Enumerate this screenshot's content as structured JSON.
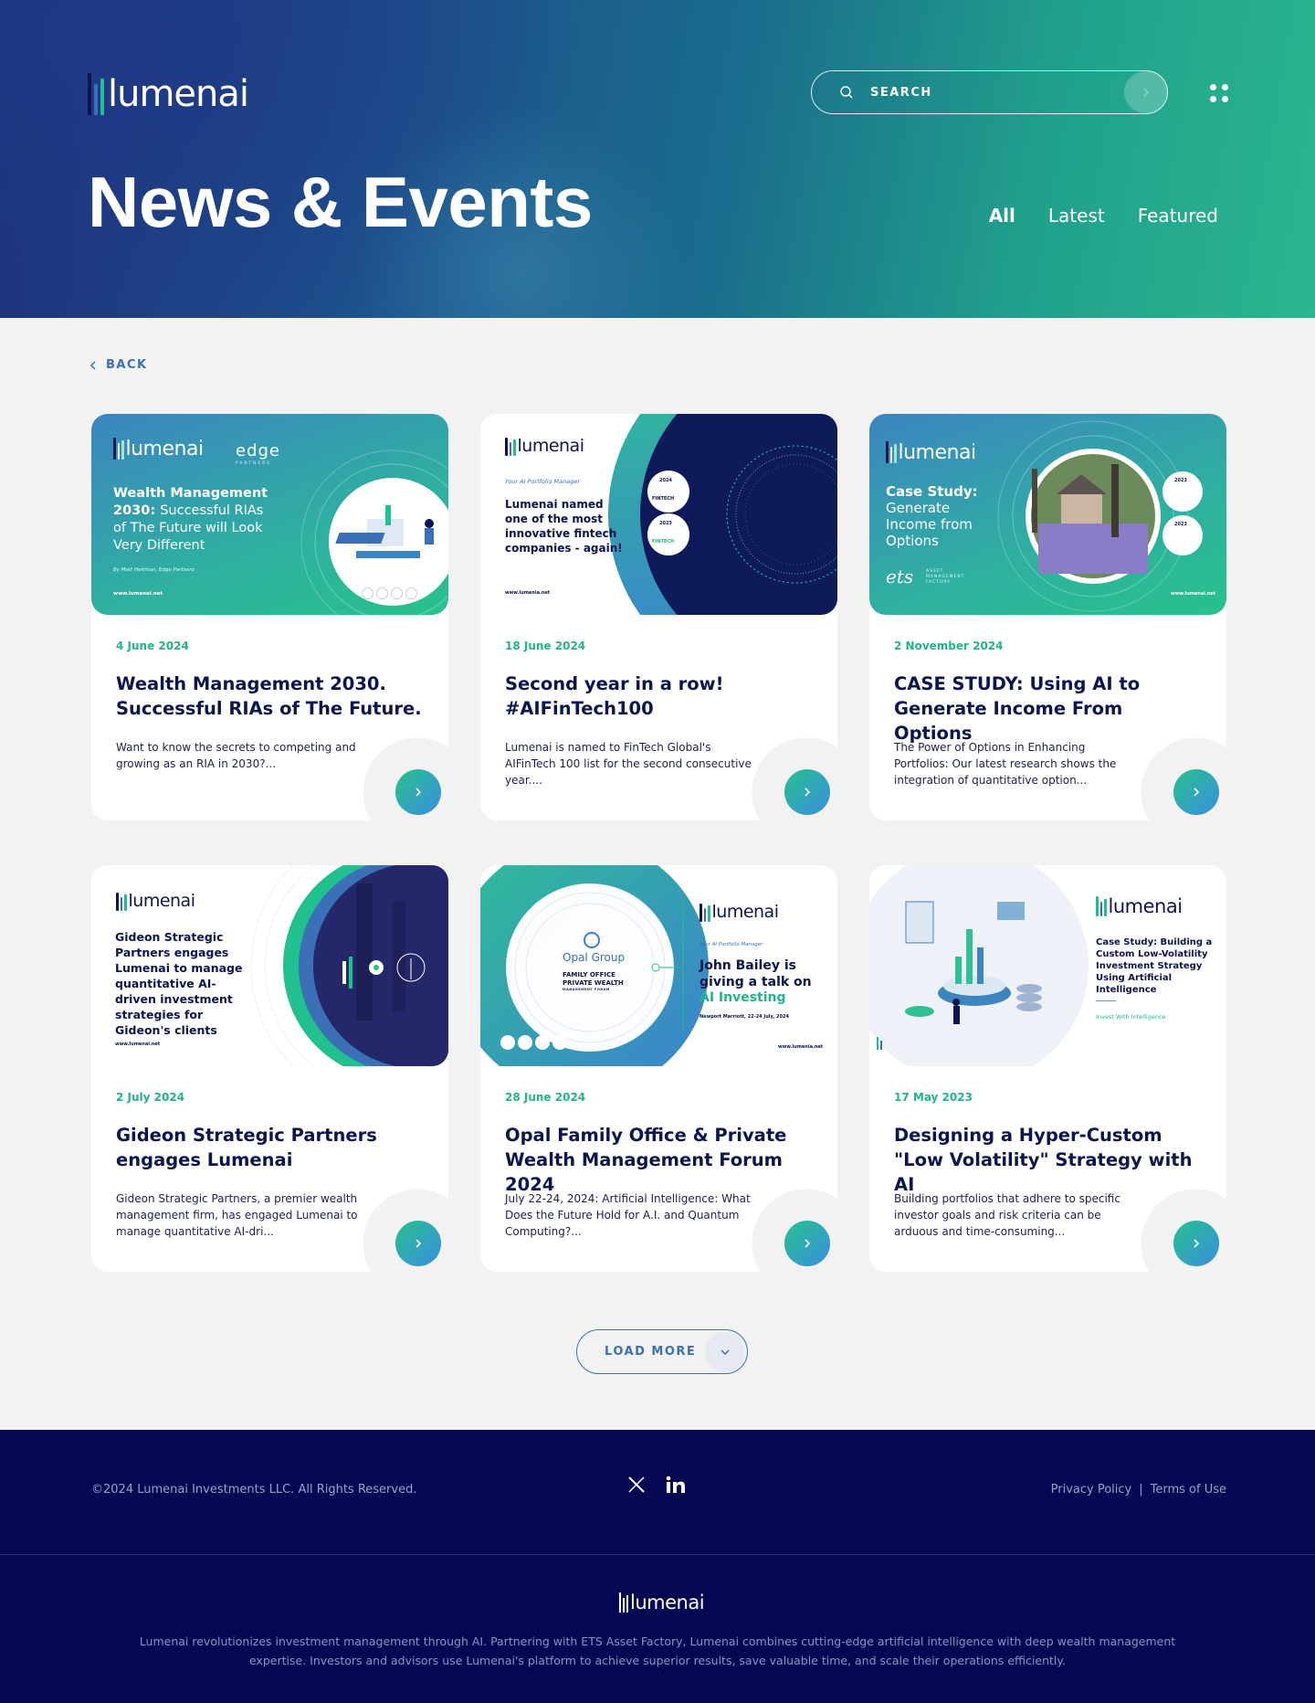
{
  "brand": {
    "name": "lumenai",
    "accent": "#22b48c",
    "navy": "#0d1452",
    "blue": "#3b6fb6"
  },
  "header": {
    "search_label": "SEARCH",
    "page_title": "News & Events",
    "filters": [
      "All",
      "Latest",
      "Featured"
    ],
    "active_filter": "All"
  },
  "nav": {
    "back_label": "BACK"
  },
  "cards": [
    {
      "date": "4 June 2024",
      "title": "Wealth Management 2030. Successful RIAs of The Future.",
      "excerpt": "Want to know the secrets to competing and growing as an RIA in 2030?...",
      "thumb": {
        "partner": "edge",
        "partner_sub": "PARTNERS",
        "head_bold": "Wealth Management 2030:",
        "head_rest": "Successful RIAs of The Future will Look Very Different",
        "byline": "By Matt Heitman, Edge Partners",
        "url": "www.lumenai.net"
      }
    },
    {
      "date": "18 June 2024",
      "title": "Second year in a row! #AIFinTech100",
      "excerpt": "Lumenai is named to FinTech Global's AIFinTech 100 list for the second consecutive year....",
      "thumb": {
        "tagline": "Your AI Portfolio Manager",
        "headline": "Lumenai named one of the most innovative fintech companies - again!",
        "url": "www.lumenia.net",
        "badge_top": "2024",
        "badge_bottom": "2023",
        "badge_label": "FINTECH"
      }
    },
    {
      "date": "2 November 2024",
      "title": "CASE STUDY: Using AI to Generate Income From Options",
      "excerpt": "The Power of Options in Enhancing Portfolios: Our latest research shows the integration of quantitative option...",
      "thumb": {
        "head_bold": "Case Study:",
        "head_rest": "Generate Income from Options",
        "partner": "ets",
        "partner_sub": "ASSET MANAGEMENT FACTORY",
        "url": "www.lumenai.net",
        "badge_top": "2023",
        "badge_bottom": "2023"
      }
    },
    {
      "date": "2 July 2024",
      "title": "Gideon Strategic Partners engages Lumenai",
      "excerpt": "Gideon Strategic Partners, a premier wealth management firm, has engaged Lumenai to manage quantitative AI-dri...",
      "thumb": {
        "headline": "Gideon Strategic Partners engages Lumenai to manage quantitative AI-driven investment strategies for Gideon's clients",
        "url": "www.lumenai.net"
      }
    },
    {
      "date": "28 June 2024",
      "title": "Opal Family Office & Private Wealth Management Forum 2024",
      "excerpt": "July 22-24, 2024: Artificial Intelligence: What Does the Future Hold for A.I. and Quantum Computing?...",
      "thumb": {
        "opal": "Opal Group",
        "forum_1": "FAMILY OFFICE",
        "forum_2": "PRIVATE WEALTH",
        "forum_3": "MANAGEMENT FORUM",
        "tagline": "Your AI Portfolio Manager",
        "headline_1": "John Bailey is giving a talk on",
        "headline_2": "AI Investing",
        "venue": "Newport Marriott, 22-24 July, 2024",
        "url": "www.lumenia.net"
      }
    },
    {
      "date": "17 May 2023",
      "title": "Designing a Hyper-Custom \"Low Volatility\" Strategy with AI",
      "excerpt": "Building portfolios that adhere to specific investor goals and risk criteria can be arduous and time-consuming...",
      "thumb": {
        "headline": "Case Study: Building a Custom Low-Volatility Investment Strategy Using Artificial Intelligence",
        "tagline": "Invest With Intelligence"
      }
    }
  ],
  "load_more_label": "LOAD MORE",
  "footer": {
    "copyright": "©2024 Lumenai Investments LLC. All Rights Reserved.",
    "privacy": "Privacy Policy",
    "separator": "|",
    "terms": "Terms of Use",
    "description": "Lumenai revolutionizes investment management through AI. Partnering with ETS Asset Factory, Lumenai combines cutting-edge artificial intelligence with deep wealth management expertise. Investors and advisors use Lumenai's platform to achieve superior results, save valuable time, and scale their operations efficiently."
  }
}
